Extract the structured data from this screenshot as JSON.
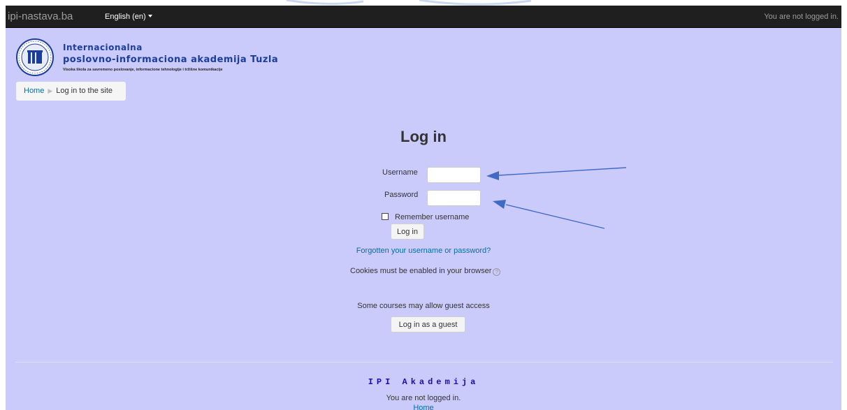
{
  "navbar": {
    "brand": "ipi-nastava.ba",
    "language": "English (en)",
    "login_status": "You are not logged in."
  },
  "header": {
    "institution_line1": "Internacionalna",
    "institution_line2": "poslovno-informaciona akademija Tuzla",
    "institution_tagline": "Visoka škola za savremeno poslovanje, informacione tehnologije i tržišne komunikacije"
  },
  "breadcrumb": {
    "home": "Home",
    "current": "Log in to the site"
  },
  "login": {
    "title": "Log in",
    "username_label": "Username",
    "password_label": "Password",
    "username_value": "",
    "password_value": "",
    "remember_label": "Remember username",
    "submit_label": "Log in",
    "forgot_link": "Forgotten your username or password?",
    "cookies_notice": "Cookies must be enabled in your browser",
    "guest_notice": "Some courses may allow guest access",
    "guest_button": "Log in as a guest"
  },
  "footer": {
    "title": "IPI Akademija",
    "login_status": "You are not logged in.",
    "home_link": "Home"
  },
  "colors": {
    "page_background": "#cbcbfb",
    "navbar_background": "#1f1f1f",
    "link": "#0070a8",
    "annotation_arrow": "#3f6bc4"
  },
  "icons": [
    "caret-down-icon",
    "institution-logo",
    "help-icon",
    "annotation-arrow"
  ]
}
